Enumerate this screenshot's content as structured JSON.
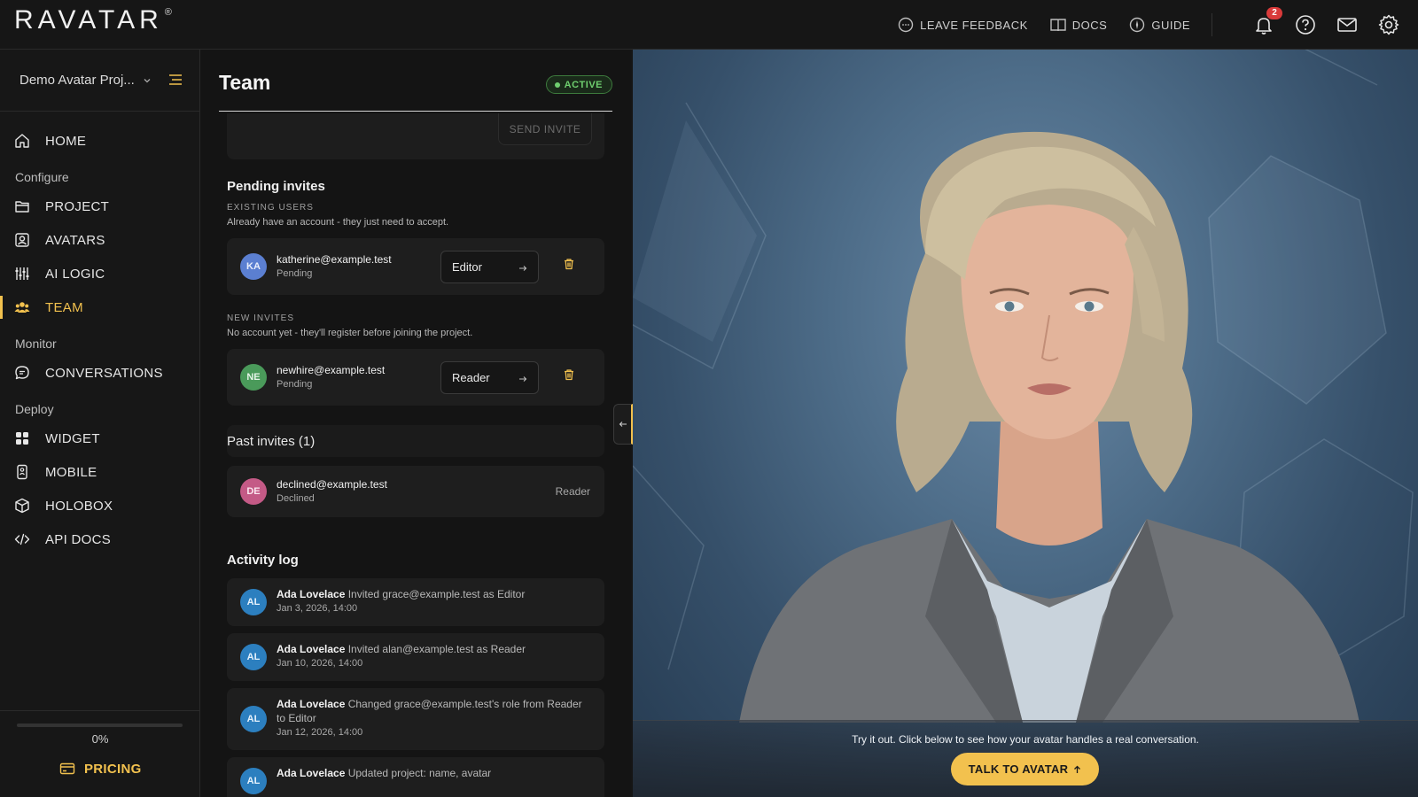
{
  "app": {
    "logo_text": "RAVATAR",
    "logo_mark": "®"
  },
  "topbar": {
    "feedback_label": "LEAVE FEEDBACK",
    "docs_label": "DOCS",
    "guide_label": "GUIDE",
    "notification_count": "2",
    "icons": [
      "bell-icon",
      "help-icon",
      "mail-icon",
      "gear-icon"
    ]
  },
  "sidebar": {
    "project_name": "Demo Avatar Proj...",
    "home": "HOME",
    "sections": {
      "configure": "Configure",
      "monitor": "Monitor",
      "deploy": "Deploy"
    },
    "items": {
      "project": "PROJECT",
      "avatars": "AVATARS",
      "ai_logic": "AI LOGIC",
      "team": "TEAM",
      "conversations": "CONVERSATIONS",
      "widget": "WIDGET",
      "mobile": "MOBILE",
      "holobox": "HOLOBOX",
      "api_docs": "API DOCS"
    },
    "progress": {
      "value": 0,
      "label": "0%"
    },
    "pricing_label": "PRICING",
    "accent_color": "#f2c14e"
  },
  "team": {
    "title": "Team",
    "status": "ACTIVE",
    "send_invite_label": "SEND INVITE",
    "pending": {
      "heading": "Pending invites",
      "existing_label": "EXISTING USERS",
      "existing_desc": "Already have an account - they just need to accept.",
      "existing": [
        {
          "initials": "KA",
          "email": "katherine@example.test",
          "status": "Pending",
          "role": "Editor",
          "color": "#5b7fd1"
        }
      ],
      "new_label": "NEW INVITES",
      "new_desc": "No account yet - they'll register before joining the project.",
      "new": [
        {
          "initials": "NE",
          "email": "newhire@example.test",
          "status": "Pending",
          "role": "Reader",
          "color": "#4a9a5a"
        }
      ]
    },
    "past": {
      "heading": "Past invites (1)",
      "items": [
        {
          "initials": "DE",
          "email": "declined@example.test",
          "status": "Declined",
          "role": "Reader",
          "color": "#c45a86"
        }
      ]
    },
    "activity": {
      "heading": "Activity log",
      "items": [
        {
          "initials": "AL",
          "actor": "Ada Lovelace",
          "action": "Invited grace@example.test as Editor",
          "time": "Jan 3, 2026, 14:00"
        },
        {
          "initials": "AL",
          "actor": "Ada Lovelace",
          "action": "Invited alan@example.test as Reader",
          "time": "Jan 10, 2026, 14:00"
        },
        {
          "initials": "AL",
          "actor": "Ada Lovelace",
          "action": "Changed grace@example.test's role from Reader to Editor",
          "time": "Jan 12, 2026, 14:00"
        },
        {
          "initials": "AL",
          "actor": "Ada Lovelace",
          "action": "Updated project: name, avatar",
          "time": ""
        }
      ]
    }
  },
  "preview": {
    "cta_text": "Try it out. Click below to see how your avatar handles a real conversation.",
    "cta_button": "TALK TO AVATAR",
    "cta_icon": "arrow-up-icon"
  }
}
